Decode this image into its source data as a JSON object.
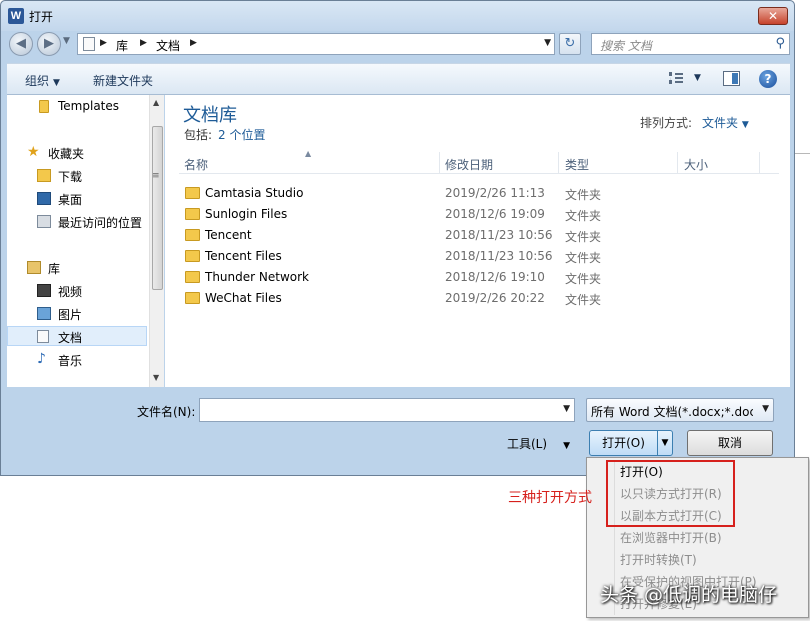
{
  "window": {
    "title": "打开",
    "app_icon_letter": "W",
    "close_glyph": "✕"
  },
  "address": {
    "crumbs": [
      "库",
      "文档"
    ],
    "search_placeholder": "搜索 文档"
  },
  "toolbar": {
    "organize": "组织",
    "new_folder": "新建文件夹"
  },
  "sidebar": {
    "items": [
      {
        "label": "Templates"
      },
      {
        "label": "收藏夹"
      },
      {
        "label": "下载"
      },
      {
        "label": "桌面"
      },
      {
        "label": "最近访问的位置"
      },
      {
        "label": "库"
      },
      {
        "label": "视频"
      },
      {
        "label": "图片"
      },
      {
        "label": "文档"
      },
      {
        "label": "音乐"
      }
    ]
  },
  "content": {
    "title": "文档库",
    "includes_label": "包括:",
    "includes_link": "2 个位置",
    "arrange_label": "排列方式:",
    "arrange_value": "文件夹",
    "columns": [
      "名称",
      "修改日期",
      "类型",
      "大小"
    ],
    "rows": [
      {
        "name": "Camtasia Studio",
        "date": "2019/2/26 11:13",
        "type": "文件夹"
      },
      {
        "name": "Sunlogin Files",
        "date": "2018/12/6 19:09",
        "type": "文件夹"
      },
      {
        "name": "Tencent",
        "date": "2018/11/23 10:56",
        "type": "文件夹"
      },
      {
        "name": "Tencent Files",
        "date": "2018/11/23 10:56",
        "type": "文件夹"
      },
      {
        "name": "Thunder Network",
        "date": "2018/12/6 19:10",
        "type": "文件夹"
      },
      {
        "name": "WeChat Files",
        "date": "2019/2/26 20:22",
        "type": "文件夹"
      }
    ]
  },
  "footer": {
    "filename_label": "文件名(N):",
    "filename_value": "",
    "filter_value": "所有 Word 文档(*.docx;*.docm",
    "tools_label": "工具(L)",
    "open_label": "打开(O)",
    "cancel_label": "取消"
  },
  "open_menu": {
    "items": [
      {
        "label": "打开(O)",
        "enabled": true
      },
      {
        "label": "以只读方式打开(R)",
        "enabled": false
      },
      {
        "label": "以副本方式打开(C)",
        "enabled": false
      },
      {
        "label": "在浏览器中打开(B)",
        "enabled": false
      },
      {
        "label": "打开时转换(T)",
        "enabled": false
      },
      {
        "label": "在受保护的视图中打开(P)",
        "enabled": false
      },
      {
        "label": "打开并修复(E)",
        "enabled": false
      }
    ]
  },
  "annotation": {
    "text": "三种打开方式",
    "color": "#d6201c"
  },
  "watermark": {
    "text": "头条 @低调的电脑仔"
  }
}
